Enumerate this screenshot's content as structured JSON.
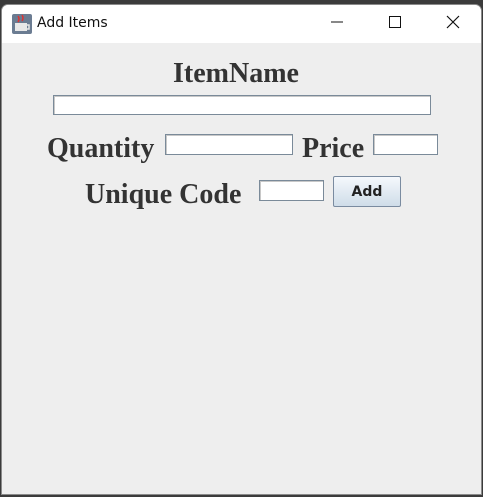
{
  "window": {
    "title": "Add Items"
  },
  "form": {
    "item_name_label": "ItemName",
    "item_name_value": "",
    "quantity_label": "Quantity",
    "quantity_value": "",
    "price_label": "Price",
    "price_value": "",
    "unique_code_label": "Unique Code",
    "unique_code_value": "",
    "add_button_label": "Add"
  },
  "colors": {
    "window_bg": "#eeeeee",
    "titlebar_bg": "#ffffff",
    "button_gradient_top": "#f5f8fc",
    "button_gradient_bottom": "#cfdde9"
  },
  "icons": {
    "app": "java-cup-icon",
    "minimize": "minimize-icon",
    "maximize": "maximize-icon",
    "close": "close-icon"
  }
}
